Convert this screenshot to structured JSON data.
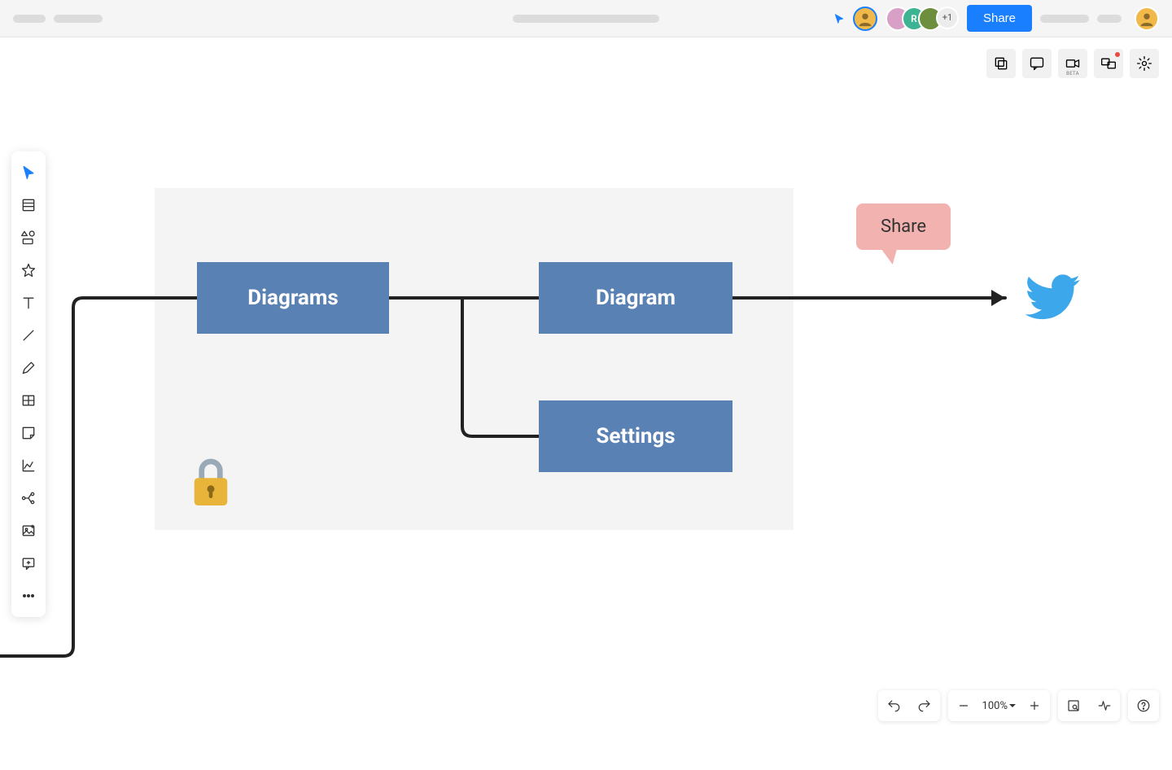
{
  "header": {
    "share_label": "Share",
    "overflow_count": "+1",
    "collaborators": [
      {
        "initial": "",
        "bg": "#f0b94a"
      },
      {
        "initial": "",
        "bg": "#d9a0c7"
      },
      {
        "initial": "R",
        "bg": "#3cb392"
      },
      {
        "initial": "",
        "bg": "#6d8f3d"
      }
    ],
    "me_avatar_bg": "#f0b94a"
  },
  "toolbar_tr": {
    "video_beta_label": "BETA"
  },
  "canvas": {
    "nodes": {
      "diagrams": "Diagrams",
      "diagram": "Diagram",
      "settings": "Settings"
    },
    "share_callout": "Share",
    "icons": {
      "lock": "lock-icon",
      "twitter": "twitter-icon"
    }
  },
  "bottombar": {
    "zoom_label": "100%"
  },
  "colors": {
    "primary": "#1a7fff",
    "node": "#5a81b3",
    "bubble": "#f2b2b0",
    "twitter": "#3da7eb"
  }
}
